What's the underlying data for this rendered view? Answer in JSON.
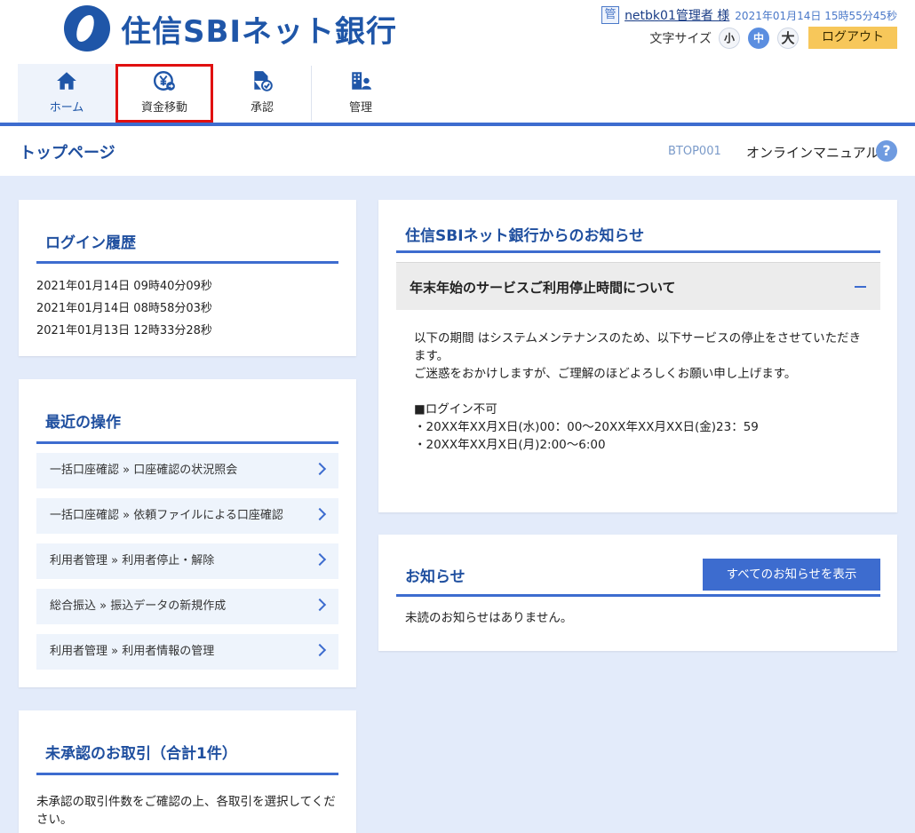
{
  "brand": {
    "name": "住信SBIネット銀行"
  },
  "user": {
    "badge": "管",
    "name": "netbk01管理者 様",
    "datetime": "2021年01月14日 15時55分45秒"
  },
  "font_size": {
    "label": "文字サイズ",
    "small": "小",
    "medium": "中",
    "large": "大",
    "selected": "中"
  },
  "logout_label": "ログアウト",
  "nav": [
    {
      "label": "ホーム",
      "icon": "home-icon"
    },
    {
      "label": "資金移動",
      "icon": "yen-transfer-icon"
    },
    {
      "label": "承認",
      "icon": "approval-document-icon"
    },
    {
      "label": "管理",
      "icon": "management-icon"
    }
  ],
  "page": {
    "title": "トップページ",
    "screen_id": "BTOP001",
    "manual_label": "オンラインマニュアル",
    "help": "?"
  },
  "login_history": {
    "title": "ログイン履歴",
    "entries": [
      "2021年01月14日 09時40分09秒",
      "2021年01月14日 08時58分03秒",
      "2021年01月13日 12時33分28秒"
    ]
  },
  "recent_ops": {
    "title": "最近の操作",
    "items": [
      "一括口座確認 » 口座確認の状況照会",
      "一括口座確認 » 依頼ファイルによる口座確認",
      "利用者管理 » 利用者停止・解除",
      "総合振込 » 振込データの新規作成",
      "利用者管理 » 利用者情報の管理"
    ]
  },
  "pending": {
    "title": "未承認のお取引（合計1件）",
    "text": "未承認の取引件数をご確認の上、各取引を選択してください。"
  },
  "bank_notice": {
    "title": "住信SBIネット銀行からのお知らせ",
    "item_title": "年末年始のサービスご利用停止時間について",
    "lines": [
      "以下の期間 はシステムメンテナンスのため、以下サービスの停止をさせていただきます。",
      "ご迷惑をおかけしますが、ご理解のほどよろしくお願い申し上げます。",
      "",
      "■ログイン不可",
      "・20XX年XX月X日(水)00：00～20XX年XX月XX日(金)23：59",
      "・20XX年XX月X日(月)2:00～6:00"
    ]
  },
  "notices": {
    "title": "お知らせ",
    "show_all_label": "すべてのお知らせを表示",
    "empty_text": "未読のお知らせはありません。"
  },
  "colors": {
    "brand": "#1f56a8",
    "accent": "#3d6ccf",
    "logout": "#f7c75a",
    "highlight": "#e01010"
  }
}
